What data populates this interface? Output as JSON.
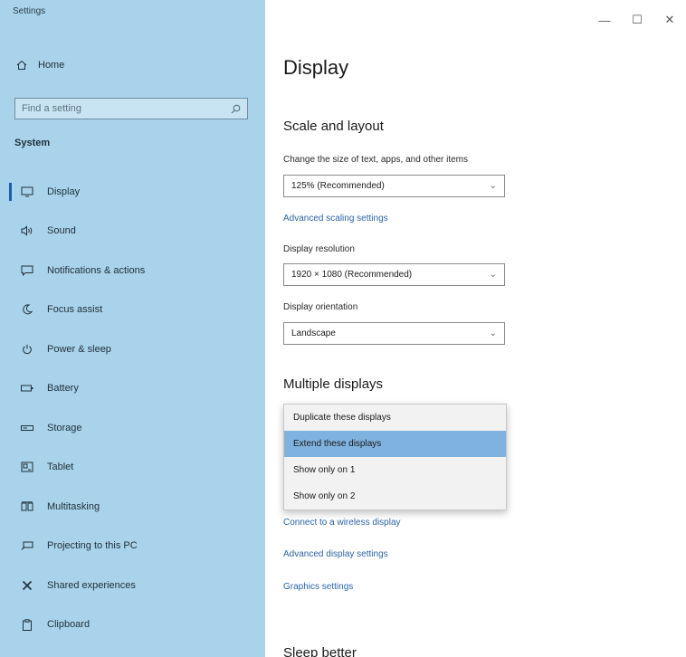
{
  "window": {
    "title": "Settings",
    "controls": {
      "minimize": "—",
      "maximize": "☐",
      "close": "✕"
    }
  },
  "sidebar": {
    "home_label": "Home",
    "search_placeholder": "Find a setting",
    "section_label": "System",
    "items": [
      {
        "label": "Display",
        "icon": "monitor-icon",
        "active": true
      },
      {
        "label": "Sound",
        "icon": "speaker-icon"
      },
      {
        "label": "Notifications & actions",
        "icon": "notification-icon"
      },
      {
        "label": "Focus assist",
        "icon": "moon-icon"
      },
      {
        "label": "Power & sleep",
        "icon": "power-icon"
      },
      {
        "label": "Battery",
        "icon": "battery-icon"
      },
      {
        "label": "Storage",
        "icon": "storage-icon"
      },
      {
        "label": "Tablet",
        "icon": "tablet-icon"
      },
      {
        "label": "Multitasking",
        "icon": "multitasking-icon"
      },
      {
        "label": "Projecting to this PC",
        "icon": "projecting-icon"
      },
      {
        "label": "Shared experiences",
        "icon": "shared-icon"
      },
      {
        "label": "Clipboard",
        "icon": "clipboard-icon"
      }
    ]
  },
  "main": {
    "page_title": "Display",
    "scale_section": "Scale and layout",
    "scale_label": "Change the size of text, apps, and other items",
    "scale_value": "125% (Recommended)",
    "advanced_scaling_link": "Advanced scaling settings",
    "resolution_label": "Display resolution",
    "resolution_value": "1920 × 1080 (Recommended)",
    "orientation_label": "Display orientation",
    "orientation_value": "Landscape",
    "multiple_section": "Multiple displays",
    "dropdown_options": [
      {
        "label": "Duplicate these displays",
        "selected": false
      },
      {
        "label": "Extend these displays",
        "selected": true
      },
      {
        "label": "Show only on 1",
        "selected": false
      },
      {
        "label": "Show only on 2",
        "selected": false
      }
    ],
    "wireless_link": "Connect to a wireless display",
    "advanced_display_link": "Advanced display settings",
    "graphics_link": "Graphics settings",
    "sleep_section": "Sleep better"
  },
  "colors": {
    "sidebar_bg": "#a9d3ea",
    "accent": "#1a5fb4",
    "link": "#2c63a8",
    "selected_option": "#7fb2de"
  }
}
